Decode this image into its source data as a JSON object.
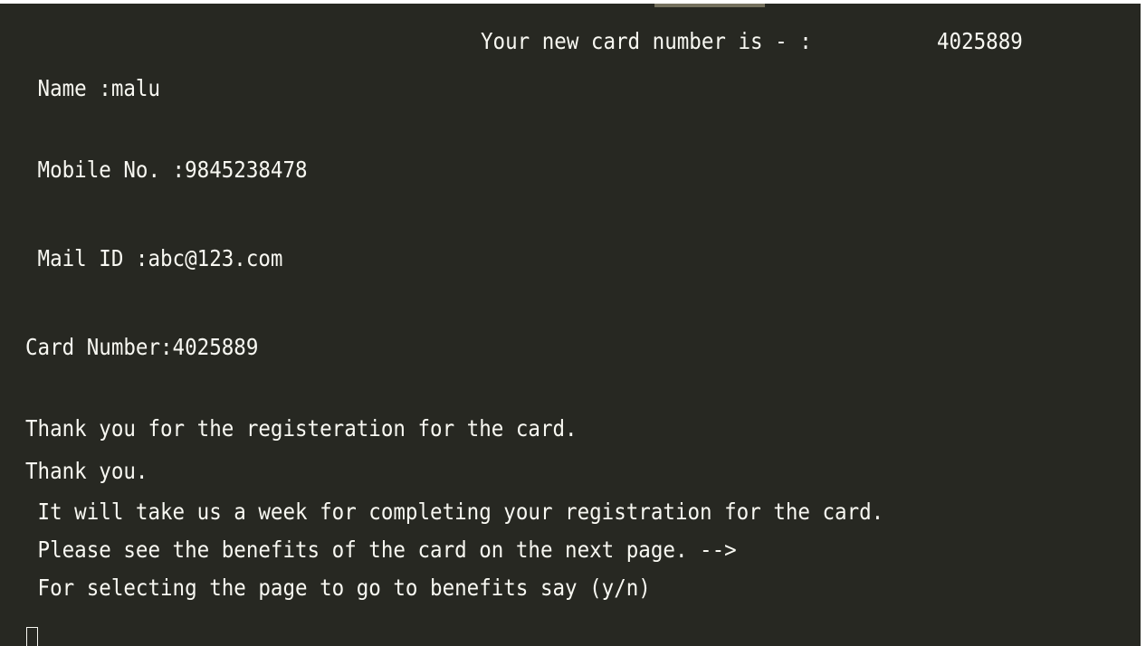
{
  "header": {
    "card_prompt": "Your new card number is - :",
    "card_value": "4025889"
  },
  "details": {
    "name": " Name :malu",
    "mobile": " Mobile No. :9845238478",
    "mail": " Mail ID :abc@123.com",
    "card": "Card Number:4025889"
  },
  "messages": [
    "Thank you for the registeration for the card.",
    "Thank you.",
    " It will take us a week for completing your registration for the card.",
    " Please see the benefits of the card on the next page. -->",
    " For selecting the page to go to benefits say (y/n)"
  ],
  "colors": {
    "background": "#272822",
    "foreground": "#f8f8f2"
  }
}
